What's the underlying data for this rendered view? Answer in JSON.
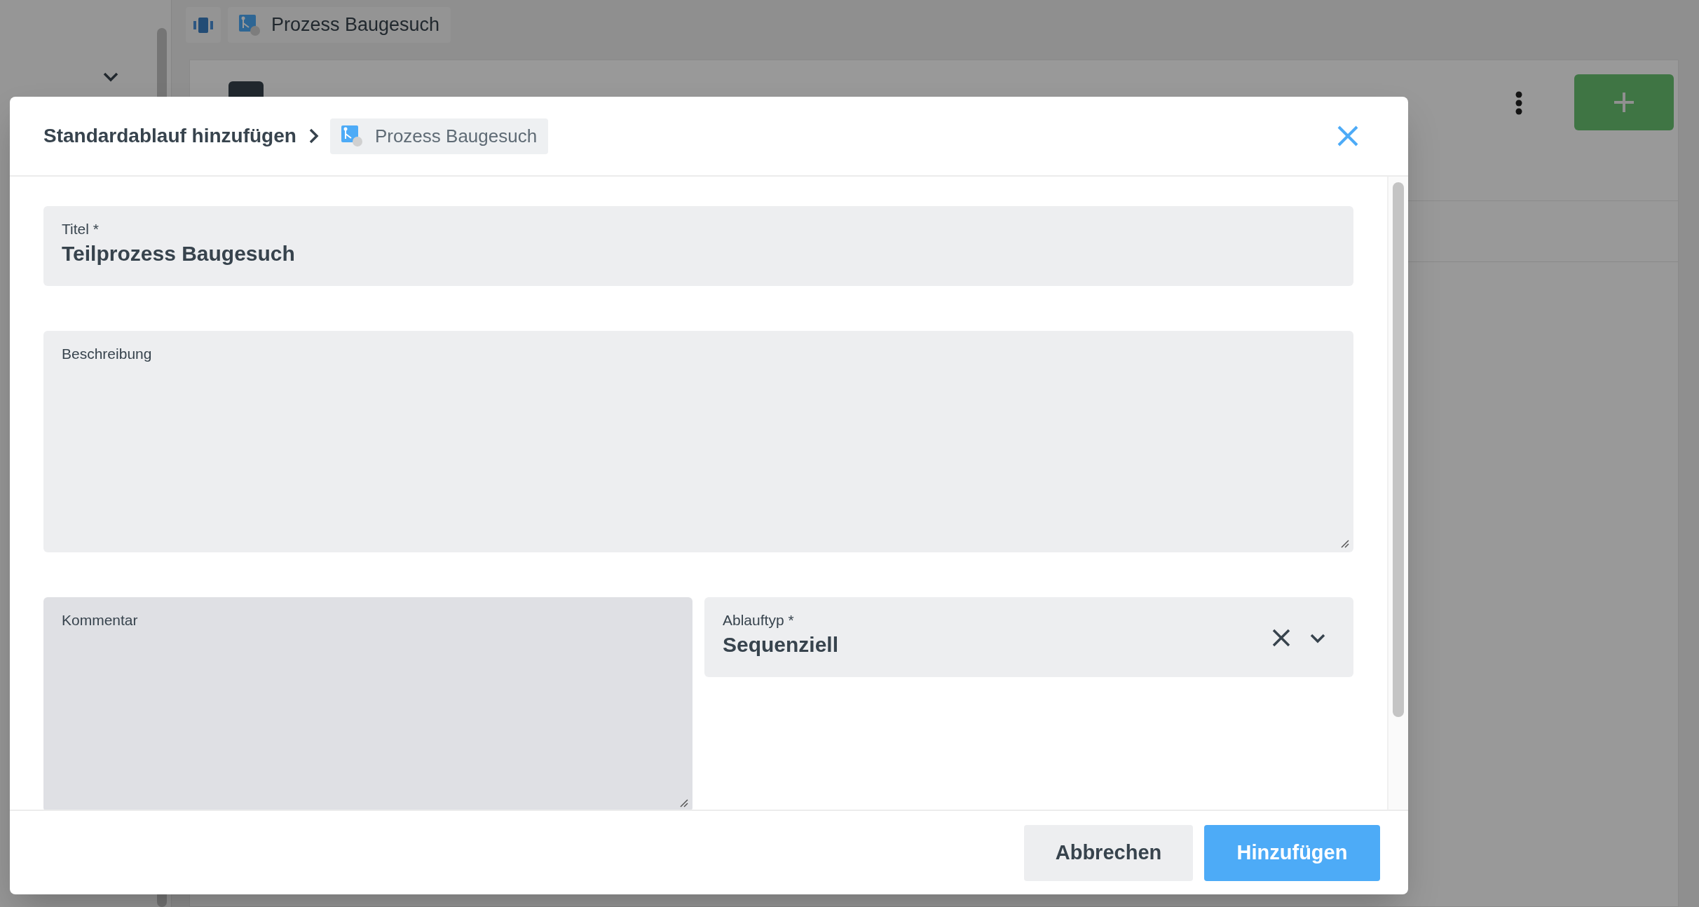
{
  "background": {
    "tab_label": "Prozess Baugesuch"
  },
  "dialog": {
    "title": "Standardablauf hinzufügen",
    "breadcrumb": "Prozess Baugesuch",
    "rows": [
      [
        {
          "kind": "text",
          "label": "Titel *",
          "value": "Teilprozess Baugesuch",
          "disabled": false
        }
      ],
      [
        {
          "kind": "textarea",
          "label": "Beschreibung",
          "disabled": false
        }
      ],
      [
        {
          "kind": "textarea",
          "label": "Kommentar",
          "disabled": true
        },
        {
          "kind": "select",
          "label": "Ablauftyp *",
          "value": "Sequenziell",
          "disabled": false
        }
      ]
    ],
    "buttons": [
      {
        "label": "Abbrechen",
        "kind": "secondary"
      },
      {
        "label": "Hinzufügen",
        "kind": "primary"
      }
    ]
  }
}
